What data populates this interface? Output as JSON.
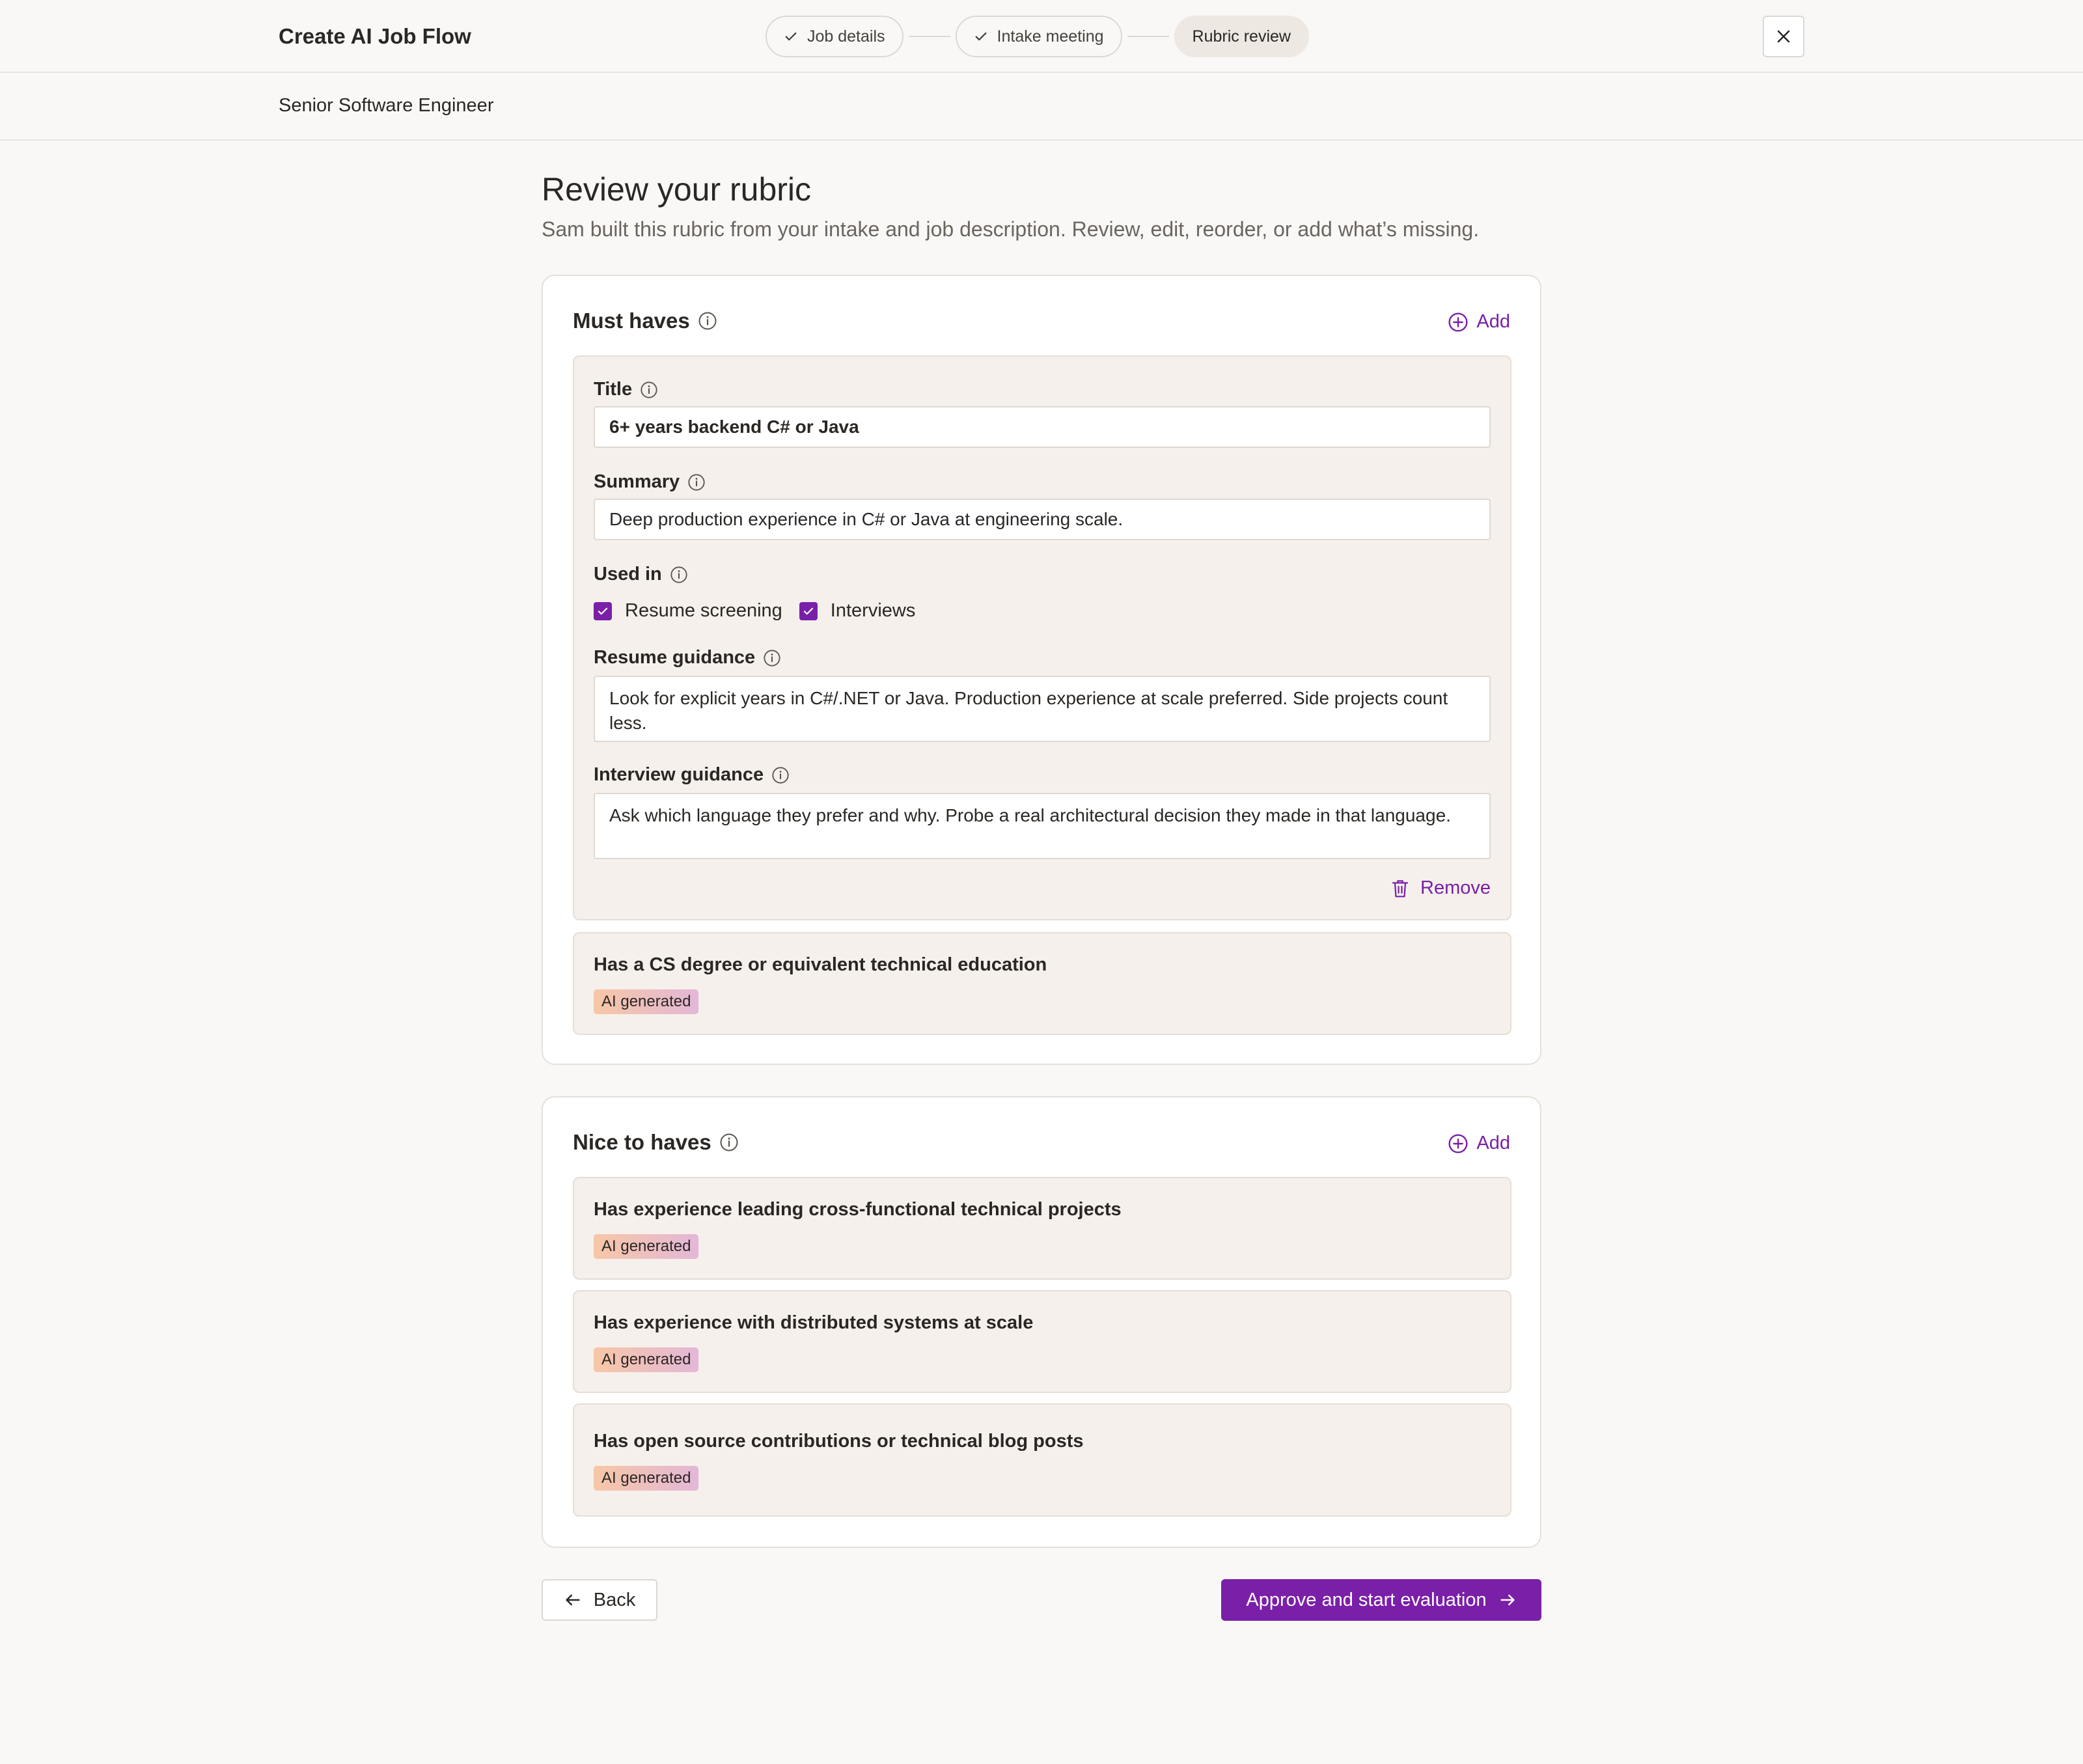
{
  "header": {
    "app_title": "Create AI Job Flow",
    "steps": [
      {
        "label": "Job details",
        "state": "done"
      },
      {
        "label": "Intake meeting",
        "state": "done"
      },
      {
        "label": "Rubric review",
        "state": "active"
      }
    ],
    "close_icon": "close-icon"
  },
  "job": {
    "name": "Senior Software Engineer"
  },
  "page": {
    "title": "Review your rubric",
    "subtitle": "Sam built this rubric from your intake and job description. Review, edit, reorder, or add what’s missing."
  },
  "must_haves": {
    "title": "Must haves",
    "add_label": "Add",
    "expanded_item": {
      "title_label": "Title",
      "title_value": "6+ years backend C# or Java",
      "summary_label": "Summary",
      "summary_value": "Deep production experience in C# or Java at engineering scale.",
      "used_in_label": "Used in",
      "used_in_options": [
        {
          "label": "Resume screening",
          "checked": true
        },
        {
          "label": "Interviews",
          "checked": true
        }
      ],
      "resume_guidance_label": "Resume guidance",
      "resume_guidance_value": "Look for explicit years in C#/.NET or Java. Production experience at scale preferred. Side projects count less.",
      "interview_guidance_label": "Interview guidance",
      "interview_guidance_value": "Ask which language they prefer and why. Probe a real architectural decision they made in that language.",
      "remove_label": "Remove"
    },
    "items": [
      {
        "title": "Has a CS degree or equivalent technical education",
        "badge": "AI generated"
      }
    ]
  },
  "nice_to_haves": {
    "title": "Nice to haves",
    "add_label": "Add",
    "items": [
      {
        "title": "Has experience leading cross-functional technical projects",
        "badge": "AI generated"
      },
      {
        "title": "Has experience with distributed systems at scale",
        "badge": "AI generated"
      },
      {
        "title": "Has open source contributions or technical blog posts",
        "badge": "AI generated"
      }
    ]
  },
  "footer": {
    "back_label": "Back",
    "approve_label": "Approve and start evaluation"
  },
  "colors": {
    "accent": "#7a1fa8",
    "background": "#f9f8f6",
    "item_bg": "#f5f0eb"
  }
}
